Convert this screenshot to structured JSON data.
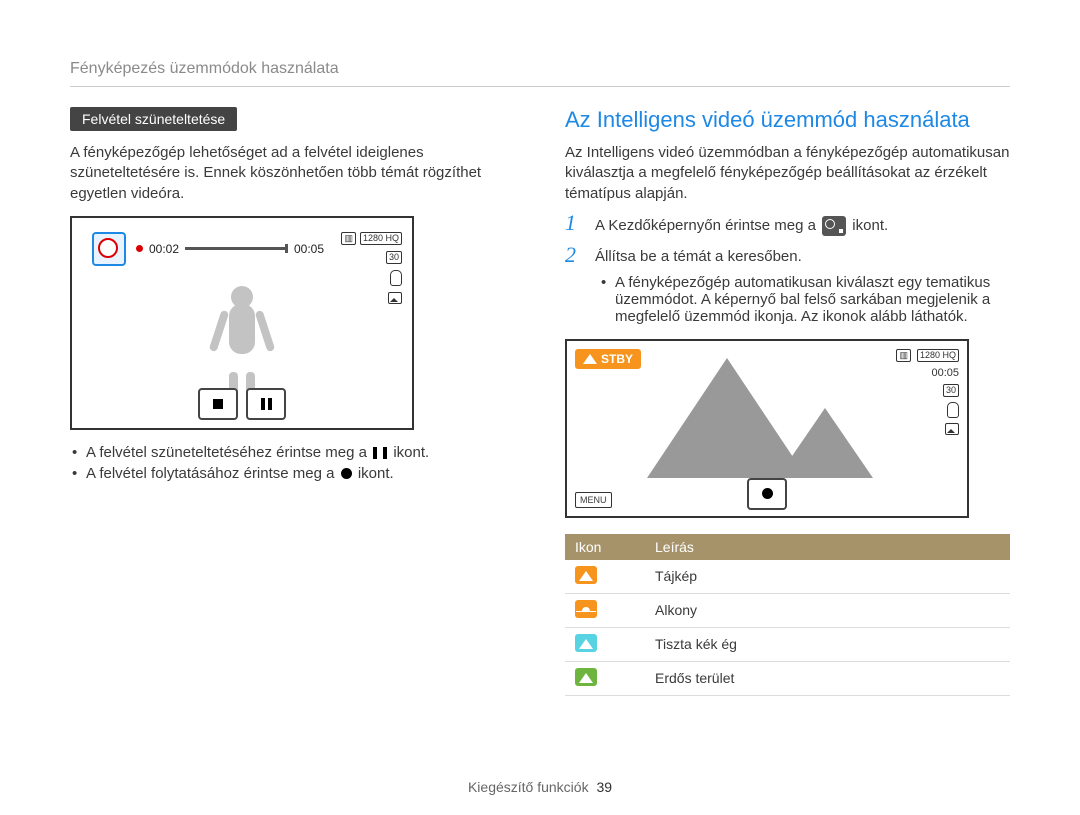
{
  "breadcrumb": "Fényképezés üzemmódok használata",
  "left": {
    "pill": "Felvétel szüneteltetése",
    "intro": "A fényképezőgép lehetőséget ad a felvétel ideiglenes szüneteltetésére is. Ennek köszönhetően több témát rögzíthet egyetlen videóra.",
    "time_elapsed": "00:02",
    "time_remaining": "00:05",
    "res_label": "1280 HQ",
    "frame_label": "30",
    "bullet1_a": "A felvétel szüneteltetéséhez érintse meg a ",
    "bullet1_b": " ikont.",
    "bullet2_a": "A felvétel folytatásához érintse meg a ",
    "bullet2_b": " ikont."
  },
  "right": {
    "title": "Az Intelligens videó üzemmód használata",
    "intro": "Az Intelligens videó üzemmódban a fényképezőgép automatikusan kiválasztja a megfelelő fényképezőgép beállításokat az érzékelt tématípus alapján.",
    "step1_a": "A Kezdőképernyőn érintse meg a ",
    "step1_b": " ikont.",
    "step2": "Állítsa be a témát a keresőben.",
    "sub_bullet": "A fényképezőgép automatikusan kiválaszt egy tematikus üzemmódot. A képernyő bal felső sarkában megjelenik a megfelelő üzemmód ikonja. Az ikonok alább láthatók.",
    "stby": "STBY",
    "time": "00:05",
    "menu": "MENU",
    "table": {
      "h1": "Ikon",
      "h2": "Leírás",
      "rows": [
        {
          "color": "orange",
          "shape": "peak",
          "label": "Tájkép"
        },
        {
          "color": "orange",
          "shape": "sun",
          "label": "Alkony"
        },
        {
          "color": "cyan",
          "shape": "peak",
          "label": "Tiszta kék ég"
        },
        {
          "color": "green",
          "shape": "peak",
          "label": "Erdős terület"
        }
      ]
    }
  },
  "footer": {
    "section": "Kiegészítő funkciók",
    "page": "39"
  }
}
